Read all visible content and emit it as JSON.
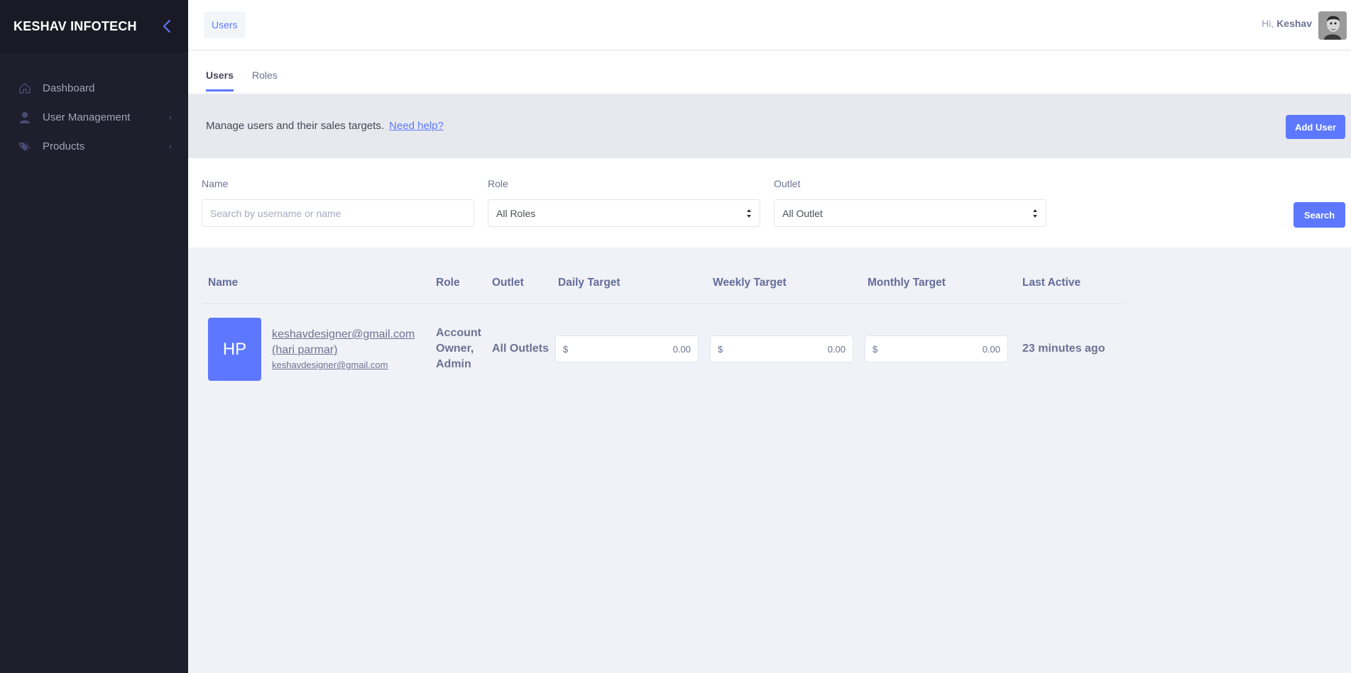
{
  "sidebar": {
    "brand": "KESHAV INFOTECH",
    "collapse_icon": "chevron-left-icon",
    "items": [
      {
        "label": "Dashboard",
        "icon": "home-icon",
        "has_submenu": false
      },
      {
        "label": "User Management",
        "icon": "user-icon",
        "has_submenu": true
      },
      {
        "label": "Products",
        "icon": "tags-icon",
        "has_submenu": true
      }
    ]
  },
  "header": {
    "breadcrumb": "Users",
    "greeting_prefix": "Hi,",
    "user_name": "Keshav"
  },
  "tabs": [
    {
      "label": "Users",
      "active": true
    },
    {
      "label": "Roles",
      "active": false
    }
  ],
  "intro": {
    "text": "Manage users and their sales targets.",
    "help_link": "Need help?",
    "add_button": "Add User"
  },
  "filters": {
    "name_label": "Name",
    "name_placeholder": "Search by username or name",
    "role_label": "Role",
    "role_value": "All Roles",
    "outlet_label": "Outlet",
    "outlet_value": "All Outlet",
    "search_button": "Search"
  },
  "table": {
    "columns": [
      "Name",
      "Role",
      "Outlet",
      "Daily Target",
      "Weekly Target",
      "Monthly Target",
      "Last Active"
    ],
    "rows": [
      {
        "initials": "HP",
        "name_line1": "keshavdesigner@gmail.com",
        "name_line2": "(hari parmar)",
        "email": "keshavdesigner@gmail.com",
        "role_lines": [
          "Account",
          "Owner,",
          "Admin"
        ],
        "outlet": "All Outlets",
        "currency": "$",
        "daily_target": "0.00",
        "weekly_target": "0.00",
        "monthly_target": "0.00",
        "last_active": "23 minutes ago"
      }
    ]
  },
  "colors": {
    "primary": "#5d78ff",
    "sidebar_bg": "#1e1e2d",
    "brand_bg": "#1a1a27",
    "content_bg": "#f0f2f7"
  }
}
